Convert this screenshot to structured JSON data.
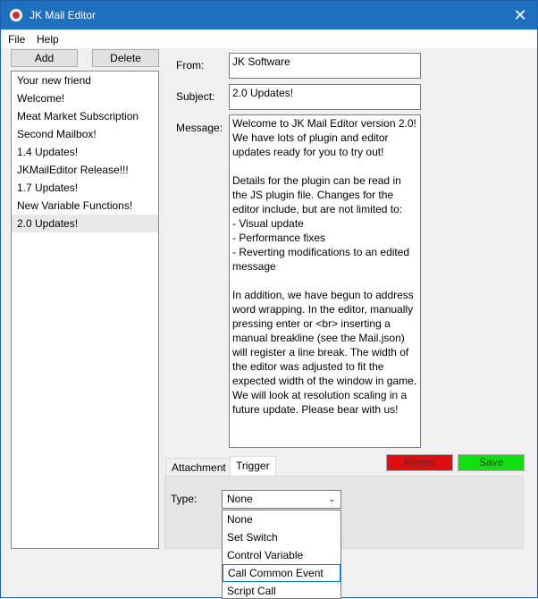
{
  "window": {
    "title": "JK Mail Editor"
  },
  "menu": [
    "File",
    "Help"
  ],
  "buttons": {
    "add": "Add",
    "delete": "Delete",
    "revert": "Revert",
    "save": "Save"
  },
  "mail_list": {
    "items": [
      "Your new friend",
      "Welcome!",
      "Meat Market Subscription",
      "Second Mailbox!",
      "1.4 Updates!",
      "JKMailEditor Release!!!",
      "1.7 Updates!",
      "New Variable Functions!",
      "2.0 Updates!"
    ],
    "selected_index": 8
  },
  "form": {
    "from_label": "From:",
    "from_value": "JK Software",
    "subject_label": "Subject:",
    "subject_value": "2.0 Updates!",
    "message_label": "Message:",
    "message_value": "Welcome to JK Mail Editor version 2.0!\nWe have lots of plugin and editor updates ready for you to try out!\n\nDetails for the plugin can be read in the JS plugin file. Changes for the editor include, but are not limited to:\n- Visual update\n- Performance fixes\n- Reverting modifications to an edited message\n\nIn addition, we have begun to address word wrapping. In the editor, manually pressing enter or <br> inserting a manual breakline (see the Mail.json) will register a line break. The width of the editor was adjusted to fit the expected width of the window in game. We will look at resolution scaling in a future update. Please bear with us!"
  },
  "tabs": [
    "Attachment",
    "Trigger"
  ],
  "active_tab": "Trigger",
  "trigger": {
    "type_label": "Type:",
    "type_value": "None",
    "options": [
      "None",
      "Set Switch",
      "Control Variable",
      "Call Common Event",
      "Script Call"
    ],
    "hovered_option": "Call Common Event"
  },
  "colors": {
    "titlebar": "#1f6fbf",
    "revert": "#dd0f10",
    "save": "#10e010"
  }
}
